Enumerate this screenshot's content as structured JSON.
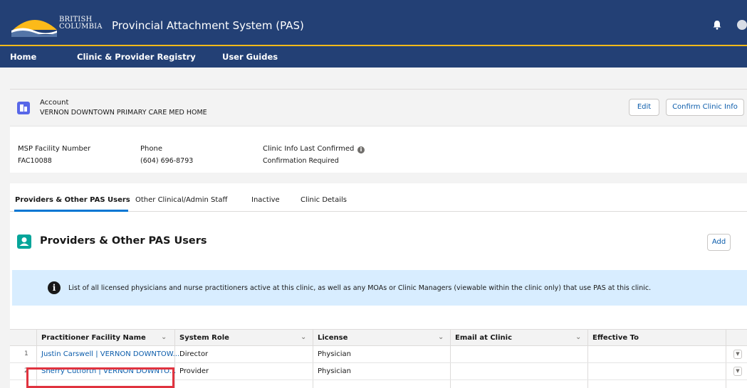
{
  "topbar": {
    "logo_text_line1": "BRITISH",
    "logo_text_line2": "COLUMBIA",
    "title": "Provincial Attachment System (PAS)",
    "icons": [
      "bell-icon",
      "user-avatar-icon"
    ]
  },
  "nav": {
    "items": [
      "Home",
      "Clinic & Provider Registry",
      "User Guides"
    ]
  },
  "account": {
    "label": "Account",
    "name": "VERNON DOWNTOWN PRIMARY CARE MED HOME",
    "edit_label": "Edit",
    "confirm_label": "Confirm Clinic Info",
    "fields": [
      {
        "label": "MSP Facility Number",
        "value": "FAC10088"
      },
      {
        "label": "Phone",
        "value": "(604) 696-8793"
      },
      {
        "label": "Clinic Info Last Confirmed",
        "value": "Confirmation Required"
      }
    ]
  },
  "tabs": [
    "Providers & Other PAS Users",
    "Other Clinical/Admin Staff",
    "Inactive",
    "Clinic Details"
  ],
  "section": {
    "title": "Providers & Other PAS Users",
    "add_label": "Add",
    "info_text": "List of all licensed physicians and nurse practitioners active at this clinic, as well as any MOAs or Clinic Managers (viewable within the clinic only) that use PAS at this clinic."
  },
  "table": {
    "columns": [
      "Practitioner Facility Name",
      "System Role",
      "License",
      "Email at Clinic",
      "Effective To"
    ],
    "rows": [
      {
        "num": "1",
        "name": "Justin Carswell | VERNON DOWNTOW...",
        "role": "Director",
        "license": "Physician",
        "email": "",
        "effective_to": ""
      },
      {
        "num": "2",
        "name": "Sherry Cutforth | VERNON DOWNTO...",
        "role": "Provider",
        "license": "Physician",
        "email": "",
        "effective_to": ""
      }
    ]
  },
  "colors": {
    "header_bg": "#234075",
    "accent_gold": "#fcba19",
    "link": "#0b5cab",
    "highlight": "#e0333f",
    "banner_bg": "#d8edff"
  }
}
